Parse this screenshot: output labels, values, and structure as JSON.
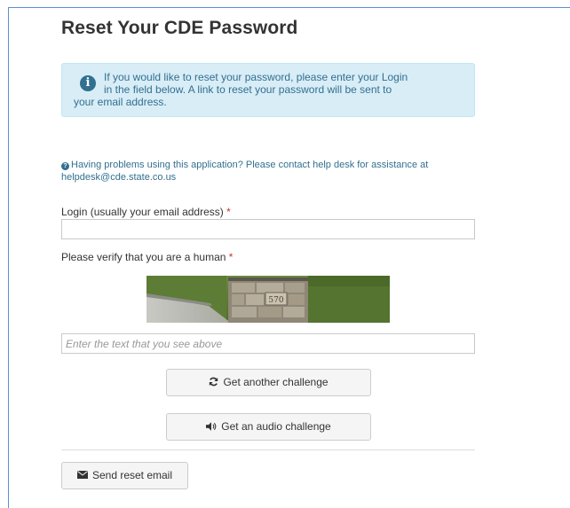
{
  "page": {
    "title": "Reset Your CDE Password"
  },
  "alert": {
    "icon": "info-icon",
    "line1": "If you would like to reset your password, please enter your Login",
    "line2": "in the field below. A link to reset your password will be sent to",
    "line3": "your email address."
  },
  "help": {
    "icon": "question-circle-icon",
    "line1": "Having problems using this application? Please contact help desk for assistance at",
    "line2": "helpdesk@cde.state.co.us"
  },
  "login": {
    "label": "Login (usually your email address)",
    "required_mark": "*",
    "value": ""
  },
  "captcha": {
    "label": "Please verify that you are a human",
    "required_mark": "*",
    "image_text": "570",
    "placeholder": "Enter the text that you see above",
    "value": ""
  },
  "buttons": {
    "another_challenge": "Get another challenge",
    "audio_challenge": "Get an audio challenge",
    "send_reset": "Send reset email"
  },
  "colors": {
    "accent": "#31708f",
    "alert_bg": "#d9edf7",
    "frame_border": "#5b8fd6",
    "required": "#c0392b"
  }
}
